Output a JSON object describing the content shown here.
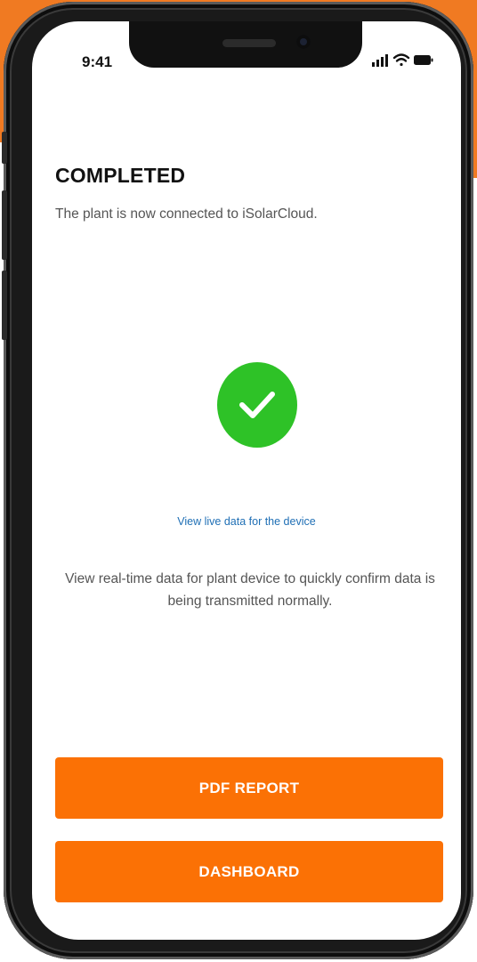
{
  "status_bar": {
    "time": "9:41",
    "icons": [
      "signal-icon",
      "wifi-icon",
      "battery-icon"
    ]
  },
  "header": {
    "title": "COMPLETED",
    "subtitle": "The plant is now connected to iSolarCloud."
  },
  "success": {
    "icon": "checkmark-icon",
    "color": "#2ec227"
  },
  "live_data": {
    "link_label": "View live data for the device",
    "description": "View real-time data for plant device to quickly confirm data is being transmitted normally."
  },
  "actions": {
    "pdf_report_label": "PDF REPORT",
    "dashboard_label": "DASHBOARD",
    "button_color": "#fb7105"
  },
  "theme": {
    "accent": "#f07a22",
    "link_color": "#1f6fb5"
  }
}
